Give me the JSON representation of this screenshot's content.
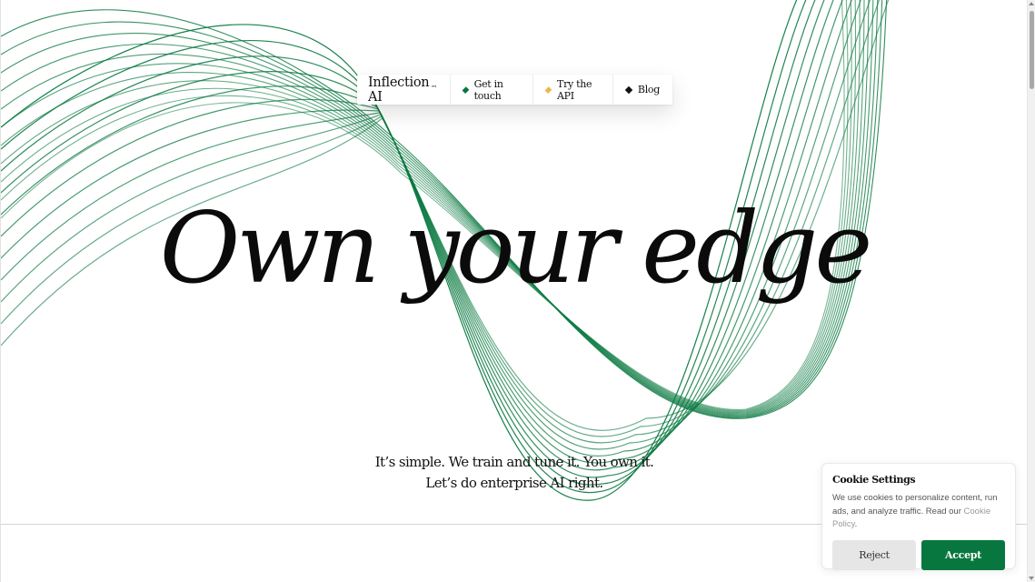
{
  "brand": {
    "logo_text": "Inflection AI",
    "logo_mark": "™"
  },
  "nav": {
    "items": [
      {
        "label": "Get in touch",
        "icon": "diamond-icon",
        "color": "#08773f"
      },
      {
        "label": "Try the API",
        "icon": "diamond-icon",
        "color": "#f0b54a"
      },
      {
        "label": "Blog",
        "icon": "diamond-icon",
        "color": "#111111"
      }
    ]
  },
  "hero": {
    "title": "Own your edge",
    "subtitle_line1": "It’s simple. We train and tune it. You own it.",
    "subtitle_line2": "Let’s do enterprise AI right."
  },
  "cookie": {
    "title": "Cookie Settings",
    "text": "We use cookies to personalize content, run ads, and analyze traffic. Read our ",
    "link": "Cookie Policy",
    "text_end": ".",
    "reject_label": "Reject",
    "accept_label": "Accept"
  },
  "colors": {
    "accent": "#08773f",
    "wave": "#0c7a42"
  }
}
